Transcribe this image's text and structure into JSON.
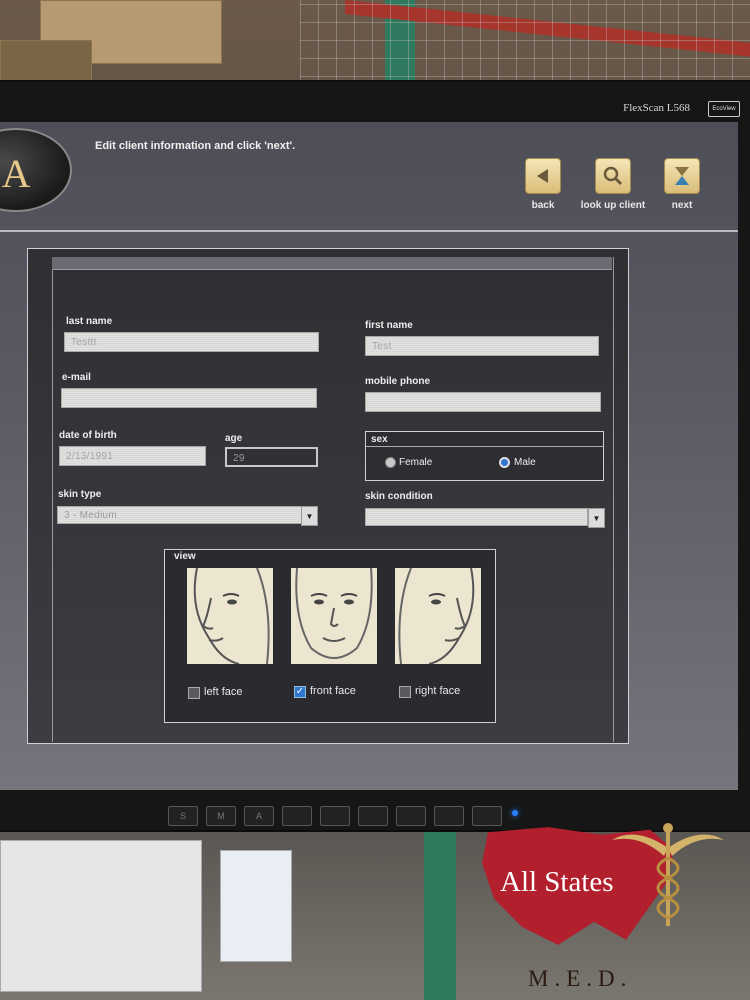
{
  "monitor": {
    "brand": "FlexScan L568",
    "badge": "EcoView"
  },
  "app": {
    "logo_text": "SIA",
    "instruction": "Edit client information and click 'next'.",
    "nav": [
      {
        "id": "back",
        "label": "back",
        "icon": "left-arrow-icon"
      },
      {
        "id": "lookup",
        "label": "look up client",
        "icon": "magnifier-icon"
      },
      {
        "id": "next",
        "label": "next",
        "icon": "hourglass-icon"
      }
    ]
  },
  "form": {
    "last_name": {
      "label": "last name",
      "value": "Testtt"
    },
    "first_name": {
      "label": "first name",
      "value": "Test"
    },
    "email": {
      "label": "e-mail",
      "value": ""
    },
    "mobile_phone": {
      "label": "mobile phone",
      "value": ""
    },
    "date_of_birth": {
      "label": "date of birth",
      "value": "2/13/1991"
    },
    "age": {
      "label": "age",
      "value": "29"
    },
    "sex": {
      "label": "sex",
      "options": [
        "Female",
        "Male"
      ],
      "selected": "Male"
    },
    "skin_type": {
      "label": "skin type",
      "value": "3 - Medium"
    },
    "skin_condition": {
      "label": "skin condition",
      "value": ""
    },
    "view": {
      "label": "view",
      "options": [
        {
          "label": "left face",
          "checked": false
        },
        {
          "label": "front face",
          "checked": true
        },
        {
          "label": "right face",
          "checked": false
        }
      ]
    }
  },
  "watermark": {
    "title": "All States",
    "subtitle": "M.E.D."
  },
  "bezel_buttons": [
    "S",
    "M",
    "A",
    "",
    "",
    "",
    "",
    "",
    ""
  ],
  "colors": {
    "accent_button": "#e3cd92",
    "checkbox_checked": "#2d77d0",
    "watermark_red": "#b21f2d"
  }
}
